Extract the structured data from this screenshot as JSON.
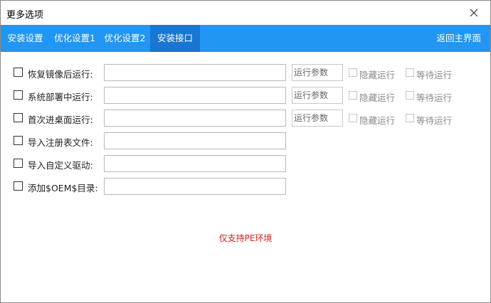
{
  "window": {
    "title": "更多选项"
  },
  "tabs": [
    {
      "label": "安装设置",
      "active": false
    },
    {
      "label": "优化设置1",
      "active": false
    },
    {
      "label": "优化设置2",
      "active": false
    },
    {
      "label": "安装接口",
      "active": true
    }
  ],
  "back_label": "返回主界面",
  "rows": [
    {
      "label": "恢复镜像后运行:",
      "checked": false,
      "path": "",
      "param_placeholder": "运行参数",
      "hide_label": "隐藏运行",
      "wait_label": "等待运行"
    },
    {
      "label": "系统部署中运行:",
      "checked": false,
      "path": "",
      "param_placeholder": "运行参数",
      "hide_label": "隐藏运行",
      "wait_label": "等待运行"
    },
    {
      "label": "首次进桌面运行:",
      "checked": false,
      "path": "",
      "param_placeholder": "运行参数",
      "hide_label": "隐藏运行",
      "wait_label": "等待运行"
    },
    {
      "label": "导入注册表文件:",
      "checked": false,
      "path": ""
    },
    {
      "label": "导入自定义驱动:",
      "checked": false,
      "path": ""
    },
    {
      "label": "添加$OEM$目录:",
      "checked": false,
      "path": ""
    }
  ],
  "notice": "仅支持PE环境",
  "colors": {
    "tabbar": "#2196f3",
    "tab_active": "#1976d2",
    "notice": "#d42020"
  }
}
